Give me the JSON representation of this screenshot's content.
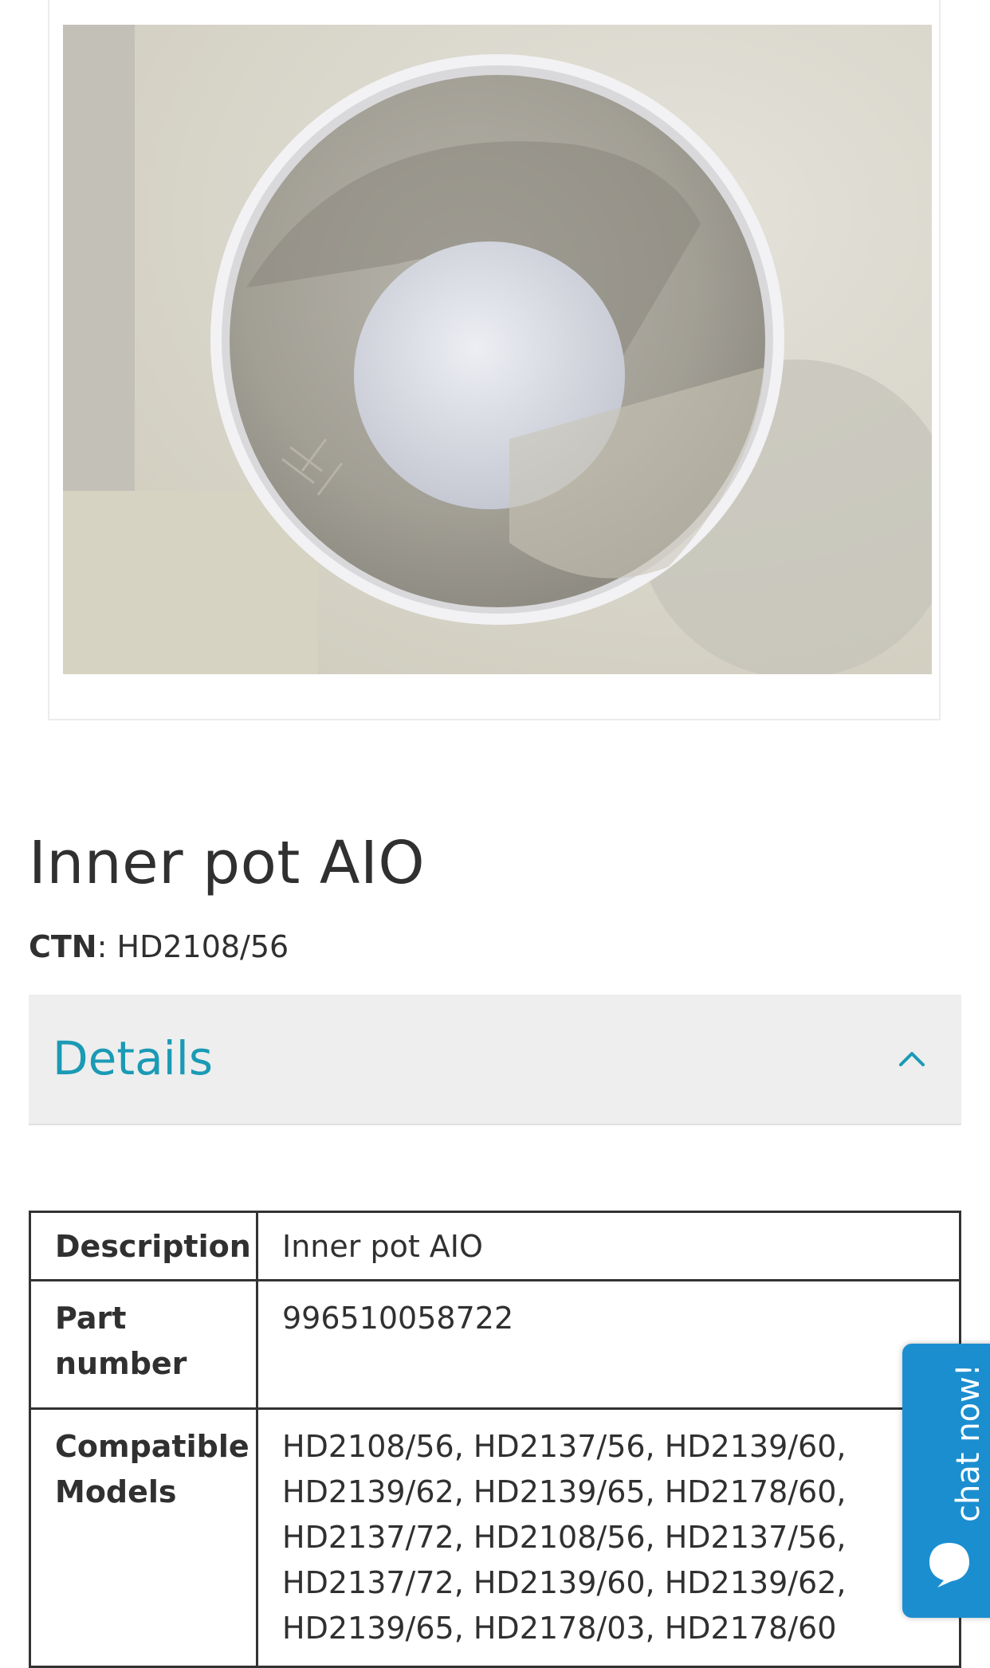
{
  "product": {
    "image_alt": "Inner pot AIO",
    "title": "Inner pot AIO",
    "ctn_label": "CTN",
    "ctn_value": ": HD2108/56"
  },
  "accordion": {
    "title": "Details",
    "expanded": true
  },
  "details_table": {
    "rows": [
      {
        "key": "Description",
        "value": "Inner pot AIO"
      },
      {
        "key": "Part number",
        "value": "996510058722"
      },
      {
        "key": "Compatible Models",
        "value": "HD2108/56, HD2137/56, HD2139/60, HD2139/62, HD2139/65, HD2178/60, HD2137/72, HD2108/56, HD2137/56, HD2137/72, HD2139/60, HD2139/62, HD2139/65, HD2178/03, HD2178/60"
      }
    ]
  },
  "chat": {
    "label": "chat now!"
  },
  "colors": {
    "accent": "#1a9ab5",
    "chat_bg": "#1b8ed0",
    "accordion_bg": "#eeeeee"
  }
}
